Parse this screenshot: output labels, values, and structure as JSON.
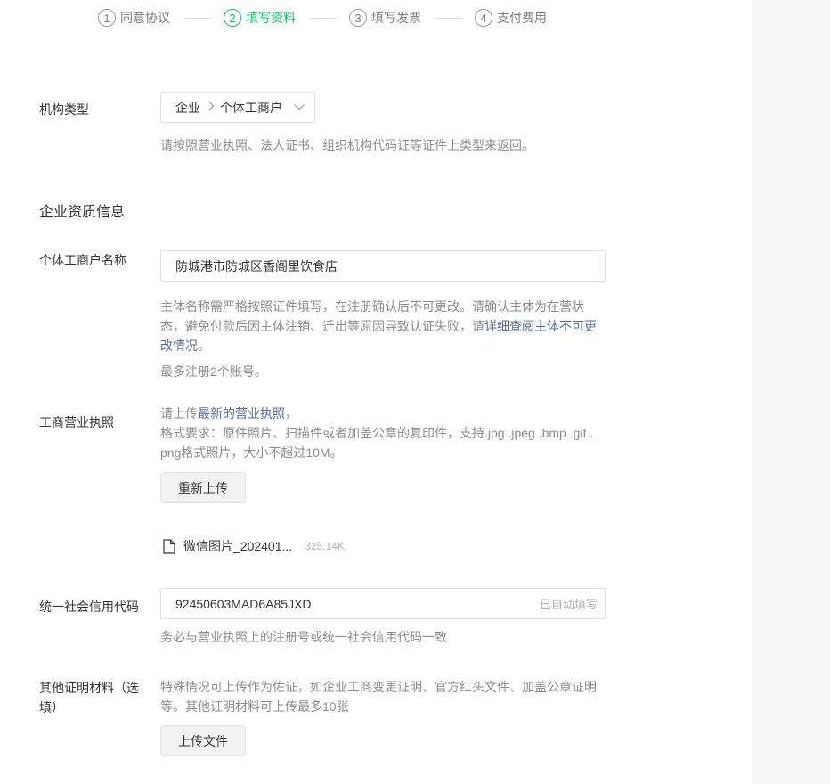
{
  "steps": [
    {
      "num": "1",
      "label": "同意协议"
    },
    {
      "num": "2",
      "label": "填写资料"
    },
    {
      "num": "3",
      "label": "填写发票"
    },
    {
      "num": "4",
      "label": "支付费用"
    }
  ],
  "org_type": {
    "label": "机构类型",
    "value_primary": "企业",
    "value_secondary": "个体工商户",
    "hint": "请按照营业执照、法人证书、组织机构代码证等证件上类型来返回。"
  },
  "section_title": "企业资质信息",
  "business_name": {
    "label": "个体工商户名称",
    "value": "防城港市防城区香阁里饮食店",
    "hint_line1": "主体名称需严格按照证件填写，在注册确认后不可更改。请确认主体为在营状",
    "hint_line2_prefix": "态，避免付款后因主体注销、迁出等原因导致认证失败，请",
    "hint_link_part1": "详细查阅主体不可更",
    "hint_link_part2": "改情况",
    "hint_line3_suffix": "。",
    "limit": "最多注册2个账号。"
  },
  "license": {
    "label": "工商营业执照",
    "hint_prefix": "请上传",
    "hint_link": "最新的营业执照",
    "hint_suffix": "，",
    "format_line1": "格式要求：原件照片、扫描件或者加盖公章的复印件，支持.jpg .jpeg .bmp .gif .",
    "format_line2": "png格式照片，大小不超过10M。",
    "reupload_button": "重新上传",
    "file_name": "微信图片_202401...",
    "file_size": "325.14K"
  },
  "credit_code": {
    "label": "统一社会信用代码",
    "value": "92450603MAD6A85JXD",
    "suffix": "已自动填写",
    "hint": "务必与营业执照上的注册号或统一社会信用代码一致"
  },
  "other_docs": {
    "label_line1": "其他证明材料（选",
    "label_line2": "填）",
    "hint_line1": "特殊情况可上传作为佐证，如企业工商变更证明、官方红头文件、加盖公章证明",
    "hint_line2": "等。其他证明材料可上传最多10张",
    "upload_button": "上传文件"
  }
}
